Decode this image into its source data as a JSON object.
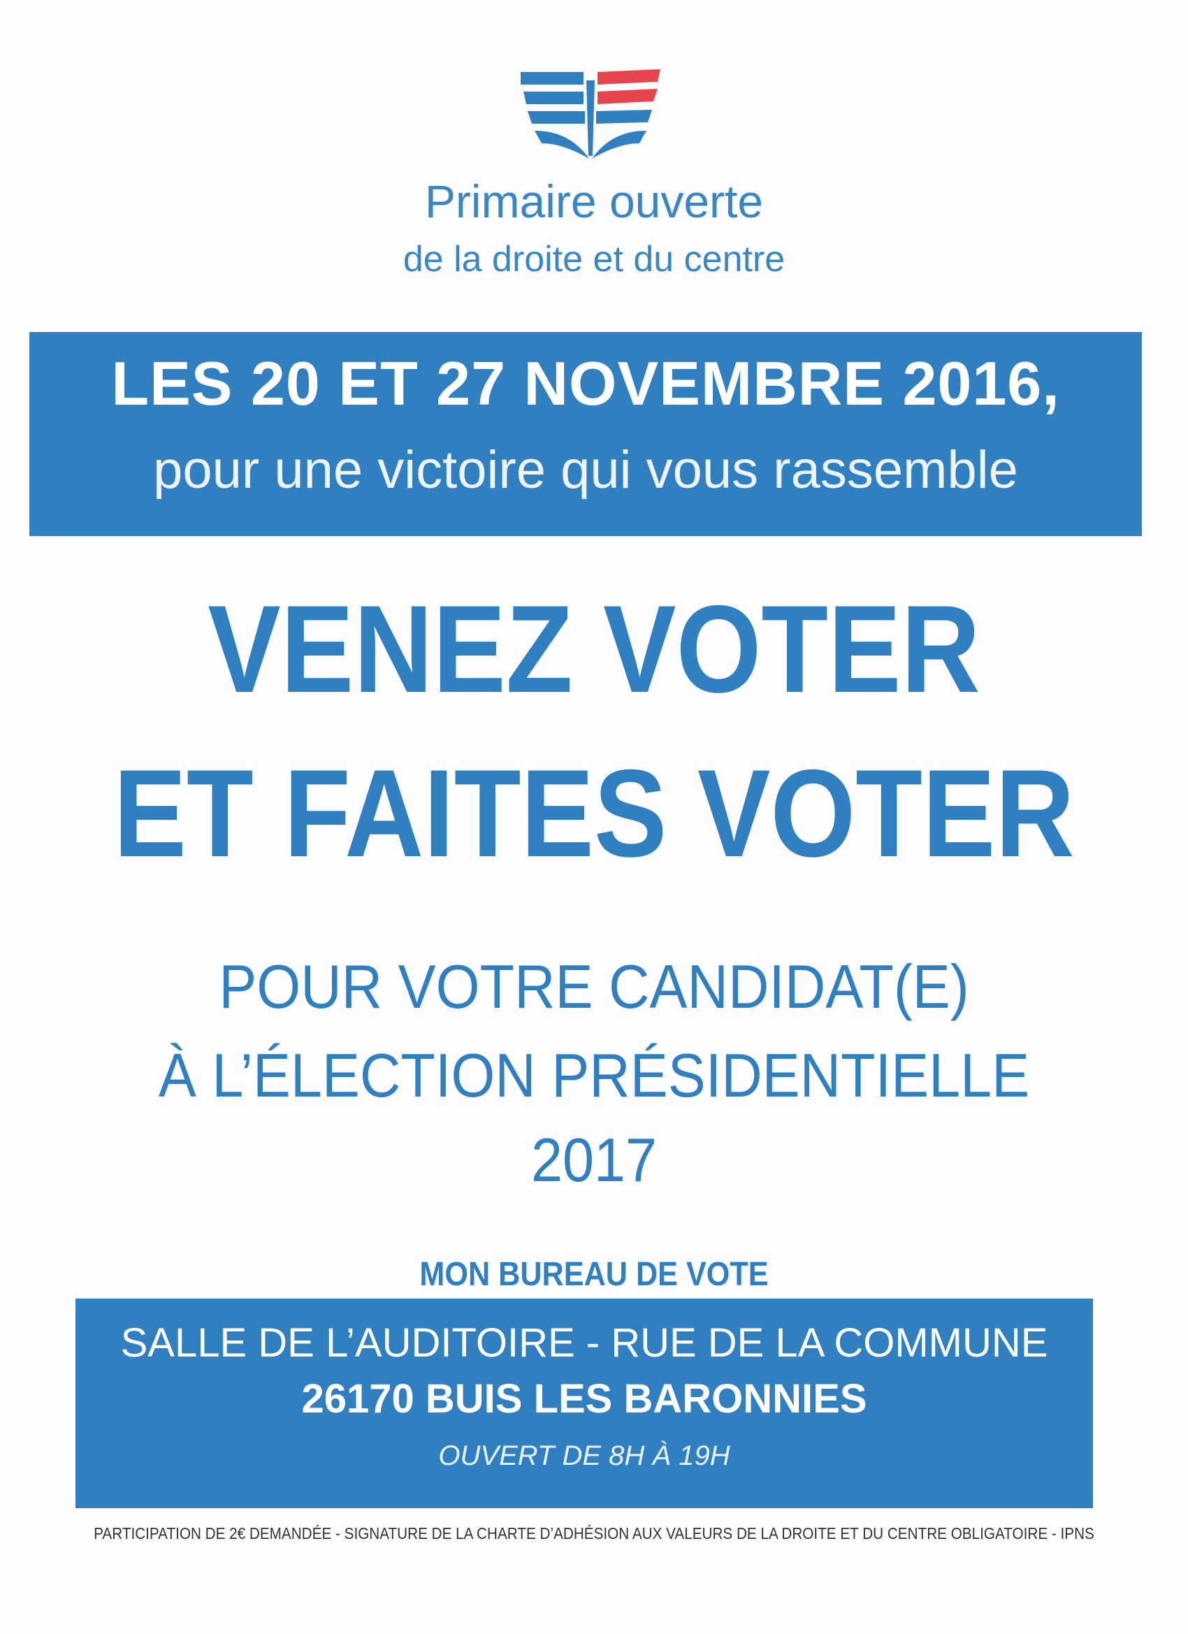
{
  "brand": {
    "line1": "Primaire ouverte",
    "line2": "de la droite et du centre",
    "logo_icon": "book-wings-logo-icon",
    "colors": {
      "blue": "#2f7fc1",
      "red": "#e8444e"
    }
  },
  "date_band": {
    "title": "LES 20 ET 27 NOVEMBRE 2016,",
    "subtitle": "pour une victoire qui vous rassemble"
  },
  "headline": {
    "line1": "VENEZ VOTER",
    "line2": "ET FAITES VOTER"
  },
  "subheadline": {
    "line1": "POUR  VOTRE CANDIDAT(E)",
    "line2": "À L’ÉLECTION PRÉSIDENTIELLE",
    "line3": "2017"
  },
  "bureau": {
    "label": "MON BUREAU DE VOTE",
    "address_line1": "SALLE DE L’AUDITOIRE - RUE DE LA COMMUNE",
    "address_line2": "26170 BUIS LES BARONNIES",
    "hours": "OUVERT DE 8H À 19H"
  },
  "footer": {
    "text": "PARTICIPATION DE 2€ DEMANDÉE - SIGNATURE DE LA CHARTE D’ADHÉSION AUX VALEURS DE LA DROITE ET DU CENTRE OBLIGATOIRE - IPNS"
  }
}
